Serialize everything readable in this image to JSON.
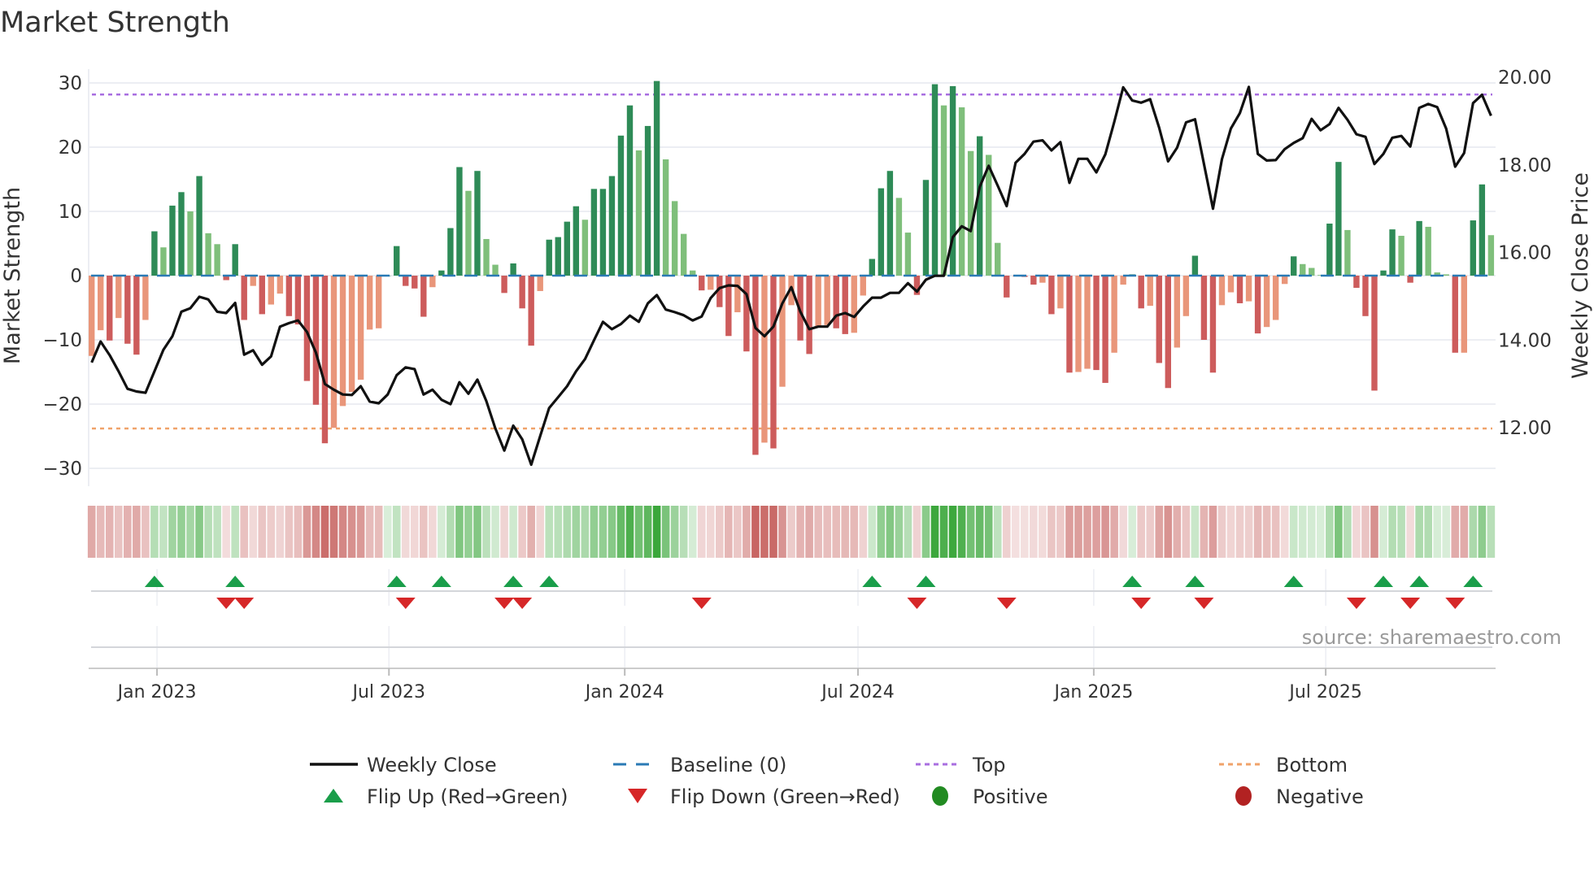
{
  "chart_data": {
    "type": "bar",
    "title": "Market Strength",
    "ylabel": "Market Strength",
    "ylabel_right": "Weekly Close Price",
    "ylim": [
      -32,
      33
    ],
    "ylim_right": [
      11,
      20.2
    ],
    "yticks": [
      -30,
      -20,
      -10,
      0,
      10,
      20,
      30
    ],
    "ytick_labels": [
      "−30",
      "−20",
      "−10",
      "0",
      "10",
      "20",
      "30"
    ],
    "yticks_right": [
      12,
      14,
      16,
      18,
      20
    ],
    "ytick_labels_right": [
      "12.00",
      "14.00",
      "16.00",
      "18.00",
      "20.00"
    ],
    "xtick_dates": [
      "2023-01-01",
      "2023-07-01",
      "2024-01-01",
      "2024-07-01",
      "2025-01-01",
      "2025-07-01"
    ],
    "xtick_labels": [
      "Jan 2023",
      "Jul 2023",
      "Jan 2024",
      "Jul 2024",
      "Jan 2025",
      "Jul 2025"
    ],
    "start_date": "2022-11-11",
    "interval_days": 7,
    "grid": true,
    "top_level": 28.2,
    "bottom_level": -23.8,
    "baseline": 0,
    "strength": [
      -12.5,
      -8.5,
      -10.1,
      -6.6,
      -10.6,
      -12.3,
      -6.9,
      6.9,
      4.4,
      10.9,
      13.0,
      10.0,
      15.5,
      6.6,
      4.9,
      -0.7,
      4.9,
      -6.9,
      -1.6,
      -6.0,
      -4.5,
      -2.8,
      -6.3,
      -7.6,
      -16.4,
      -20.1,
      -26.1,
      -23.7,
      -20.3,
      -18.1,
      -16.2,
      -8.4,
      -8.2,
      0,
      4.6,
      -1.6,
      -2.0,
      -6.4,
      -1.8,
      0.8,
      7.4,
      16.9,
      13.2,
      16.3,
      5.7,
      1.7,
      -2.7,
      1.9,
      -5.1,
      -10.9,
      -2.4,
      5.6,
      6.0,
      8.4,
      10.8,
      8.7,
      13.5,
      13.5,
      15.5,
      21.8,
      26.5,
      19.5,
      23.3,
      30.3,
      18.1,
      11.6,
      6.5,
      0.8,
      -2.3,
      -2.2,
      -4.9,
      -9.4,
      -5.7,
      -11.8,
      -27.9,
      -26.0,
      -26.9,
      -17.3,
      -4.6,
      -10.1,
      -12.2,
      -8.1,
      -7.7,
      -8.2,
      -9.1,
      -8.9,
      -3.1,
      2.6,
      13.6,
      16.3,
      12.1,
      6.7,
      -3.0,
      14.9,
      29.8,
      26.5,
      29.5,
      26.2,
      19.4,
      21.7,
      18.8,
      5.1,
      -3.4,
      -0.1,
      -0.2,
      -1.4,
      -1.1,
      -6.0,
      -5.1,
      -15.1,
      -15.0,
      -14.5,
      -14.7,
      -16.7,
      -12.0,
      -1.4,
      0.2,
      -5.1,
      -4.7,
      -13.6,
      -17.5,
      -11.2,
      -6.3,
      3.1,
      -10.0,
      -15.1,
      -4.6,
      -2.6,
      -4.3,
      -4.0,
      -9.0,
      -8.0,
      -6.9,
      -1.3,
      3.0,
      1.8,
      1.2,
      0.1,
      8.1,
      17.7,
      7.1,
      -1.9,
      -6.3,
      -17.9,
      0.8,
      7.2,
      6.2,
      -1.1,
      8.5,
      7.6,
      0.5,
      0.2,
      -12.0,
      -12.0,
      8.6,
      14.2,
      6.3
    ],
    "weekly_close": [
      13.49,
      13.97,
      13.66,
      13.29,
      12.89,
      12.83,
      12.8,
      13.29,
      13.78,
      14.09,
      14.65,
      14.73,
      14.99,
      14.93,
      14.65,
      14.62,
      14.85,
      13.67,
      13.77,
      13.44,
      13.63,
      14.31,
      14.39,
      14.45,
      14.19,
      13.72,
      13.0,
      12.87,
      12.76,
      12.75,
      12.95,
      12.6,
      12.56,
      12.76,
      13.2,
      13.38,
      13.34,
      12.76,
      12.87,
      12.64,
      12.54,
      13.04,
      12.78,
      13.1,
      12.61,
      11.99,
      11.48,
      12.05,
      11.74,
      11.16,
      11.81,
      12.45,
      12.7,
      12.95,
      13.29,
      13.57,
      14.0,
      14.42,
      14.25,
      14.37,
      14.56,
      14.42,
      14.84,
      15.03,
      14.7,
      14.64,
      14.57,
      14.45,
      14.54,
      14.96,
      15.19,
      15.25,
      15.24,
      15.05,
      14.28,
      14.09,
      14.31,
      14.84,
      15.21,
      14.65,
      14.25,
      14.31,
      14.31,
      14.56,
      14.62,
      14.53,
      14.77,
      14.97,
      14.97,
      15.08,
      15.08,
      15.3,
      15.11,
      15.38,
      15.47,
      15.47,
      16.35,
      16.6,
      16.49,
      17.5,
      17.98,
      17.53,
      17.06,
      18.05,
      18.25,
      18.53,
      18.56,
      18.33,
      18.52,
      17.59,
      18.14,
      18.14,
      17.83,
      18.24,
      18.98,
      19.77,
      19.47,
      19.42,
      19.5,
      18.85,
      18.08,
      18.39,
      18.97,
      19.04,
      18.02,
      17.0,
      18.13,
      18.83,
      19.18,
      19.78,
      18.25,
      18.1,
      18.11,
      18.36,
      18.5,
      18.61,
      19.05,
      18.79,
      18.93,
      19.3,
      19.03,
      18.7,
      18.64,
      18.02,
      18.25,
      18.62,
      18.66,
      18.42,
      19.3,
      19.39,
      19.32,
      18.83,
      17.96,
      18.27,
      19.41,
      19.6,
      19.12
    ],
    "flip_up_weeks": [
      7,
      16,
      34,
      39,
      47,
      51,
      87,
      93,
      116,
      123,
      134,
      144,
      148,
      154
    ],
    "flip_down_weeks": [
      15,
      17,
      35,
      46,
      48,
      68,
      92,
      102,
      117,
      124,
      141,
      147,
      152
    ],
    "legend": {
      "placement": "bottom",
      "items": [
        {
          "label": "Weekly Close",
          "symbol": "line",
          "color": "#111111"
        },
        {
          "label": "Baseline (0)",
          "symbol": "dash",
          "color": "#2a7ab5"
        },
        {
          "label": "Top",
          "symbol": "dot",
          "color": "#a86ee0"
        },
        {
          "label": "Bottom",
          "symbol": "dot",
          "color": "#f0a36a"
        },
        {
          "label": "Flip Up (Red→Green)",
          "symbol": "triangle-up",
          "color": "#1a9e4a"
        },
        {
          "label": "Flip Down (Green→Red)",
          "symbol": "triangle-down",
          "color": "#d62728"
        },
        {
          "label": "Positive",
          "symbol": "circle",
          "color": "#228b22"
        },
        {
          "label": "Negative",
          "symbol": "circle",
          "color": "#b22222"
        }
      ]
    },
    "colors": {
      "pos_rising": "#2e8b57",
      "pos_falling": "#7fbf7b",
      "neg_falling": "#cd5c5c",
      "neg_rising": "#e9967a",
      "heat_pos": "#2ca02c",
      "heat_neg": "#c0504d"
    },
    "source": "source: sharemaestro.com"
  }
}
